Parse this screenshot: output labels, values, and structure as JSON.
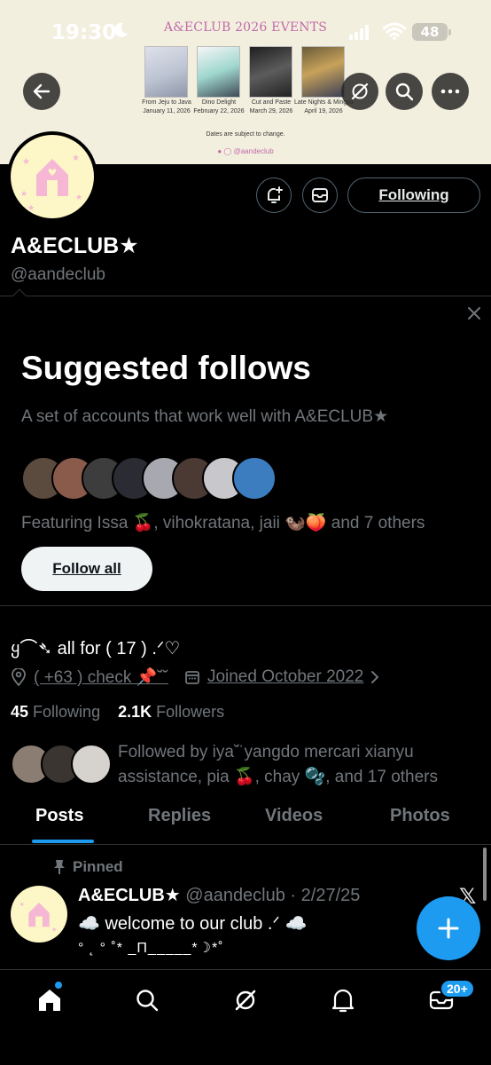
{
  "status_bar": {
    "time": "19:30",
    "battery": "48"
  },
  "banner": {
    "title": "A&ECLUB 2026 EVENTS",
    "events": [
      {
        "poster_text": "From Jeju to Java",
        "name": "From Jeju to Java",
        "date": "January 11, 2026"
      },
      {
        "poster_text": "",
        "name": "Dino Delight",
        "date": "February 22, 2026"
      },
      {
        "poster_text": "CUT AND PASTE",
        "name": "Cut and Paste",
        "date": "March 29, 2026"
      },
      {
        "poster_text": "Late Nights",
        "name": "Late Nights & Mingyu",
        "date": "April 19, 2026"
      }
    ],
    "note": "Dates are subject to change.",
    "social": "@aandeclub"
  },
  "profile": {
    "display_name": "A&ECLUB★",
    "handle": "@aandeclub",
    "following_button": "Following",
    "bio": "ყ⌒➴ all for ( 17 ) .ᐟ♡",
    "location": "( +63 ) check 📌˘̈˘",
    "joined": "Joined October 2022",
    "following_count": "45",
    "following_label": "Following",
    "followers_count": "2.1K",
    "followers_label": "Followers",
    "followed_by": "Followed by iya˘̈ yangdo mercari xianyu assistance, pia 🍒, chay 🫧, and 17 others"
  },
  "suggested": {
    "title": "Suggested follows",
    "subtitle": "A set of accounts that work well with A&ECLUB★",
    "featuring": "Featuring Issa 🍒, vihokratana, jaii 🦦🍑 and 7 others",
    "follow_all": "Follow all",
    "avatar_colors": [
      "#5b4a3e",
      "#8a5a4a",
      "#3d3d3d",
      "#2b2b33",
      "#a8a8b0",
      "#4a3a33",
      "#c8c8cc",
      "#3b7dbf"
    ]
  },
  "tabs": [
    "Posts",
    "Replies",
    "Videos",
    "Photos"
  ],
  "post": {
    "pinned_label": "Pinned",
    "author": "A&ECLUB★",
    "handle_date": "@aandeclub · 2/27/25",
    "text": "☁️  welcome to our club .ᐟ ☁️",
    "ascii": "° ˛ ° ˚* _Π_____*☽*˚"
  },
  "bottom_nav": {
    "badge": "20+"
  },
  "colors": {
    "accent": "#1d9bf0",
    "muted": "#71767b",
    "avatar_bg": "#fdf6c6",
    "house_pink": "#f6b7d4"
  }
}
